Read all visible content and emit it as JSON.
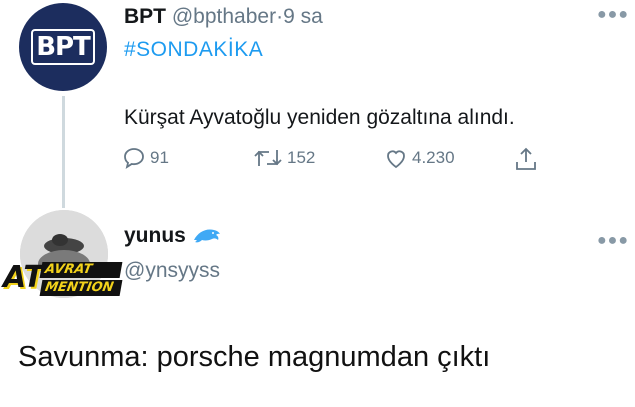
{
  "tweet": {
    "avatar_text": "BPT",
    "name": "BPT",
    "handle": "@bpthaber",
    "separator": "·",
    "time": "9 sa",
    "hashtag": "#SONDAKİKA",
    "text": "Kürşat Ayvatoğlu yeniden gözaltına alındı.",
    "more_icon": "more-horizontal-icon",
    "actions": {
      "replies": "91",
      "retweets": "152",
      "likes": "4.230"
    }
  },
  "reply_user": {
    "name": "yunus",
    "emoji_icon": "dolphin-icon",
    "handle": "@ynsyyss",
    "sticker": {
      "big": "AT",
      "line1": "AVRAT",
      "line2": "MENTION"
    }
  },
  "reply_text": "Savunma: porsche magnumdan çıktı",
  "colors": {
    "link": "#1d9bf0",
    "muted": "#657786",
    "bpt_avatar": "#1c2d5e"
  }
}
